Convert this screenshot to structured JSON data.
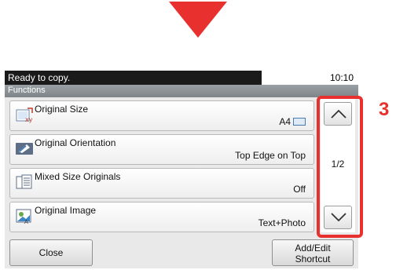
{
  "status": {
    "message": "Ready to copy.",
    "time": "10:10"
  },
  "header": {
    "title": "Functions"
  },
  "functions": [
    {
      "label": "Original Size",
      "value": "A4",
      "icon": "original-size-icon"
    },
    {
      "label": "Original Orientation",
      "value": "Top Edge on Top",
      "icon": "orientation-icon"
    },
    {
      "label": "Mixed Size Originals",
      "value": "Off",
      "icon": "mixed-size-icon"
    },
    {
      "label": "Original Image",
      "value": "Text+Photo",
      "icon": "original-image-icon"
    }
  ],
  "scroll": {
    "page": "1/2"
  },
  "footer": {
    "close_label": "Close",
    "add_edit_line1": "Add/Edit",
    "add_edit_line2": "Shortcut"
  },
  "annotation": {
    "step": "3",
    "accent_color": "#e8312f"
  }
}
